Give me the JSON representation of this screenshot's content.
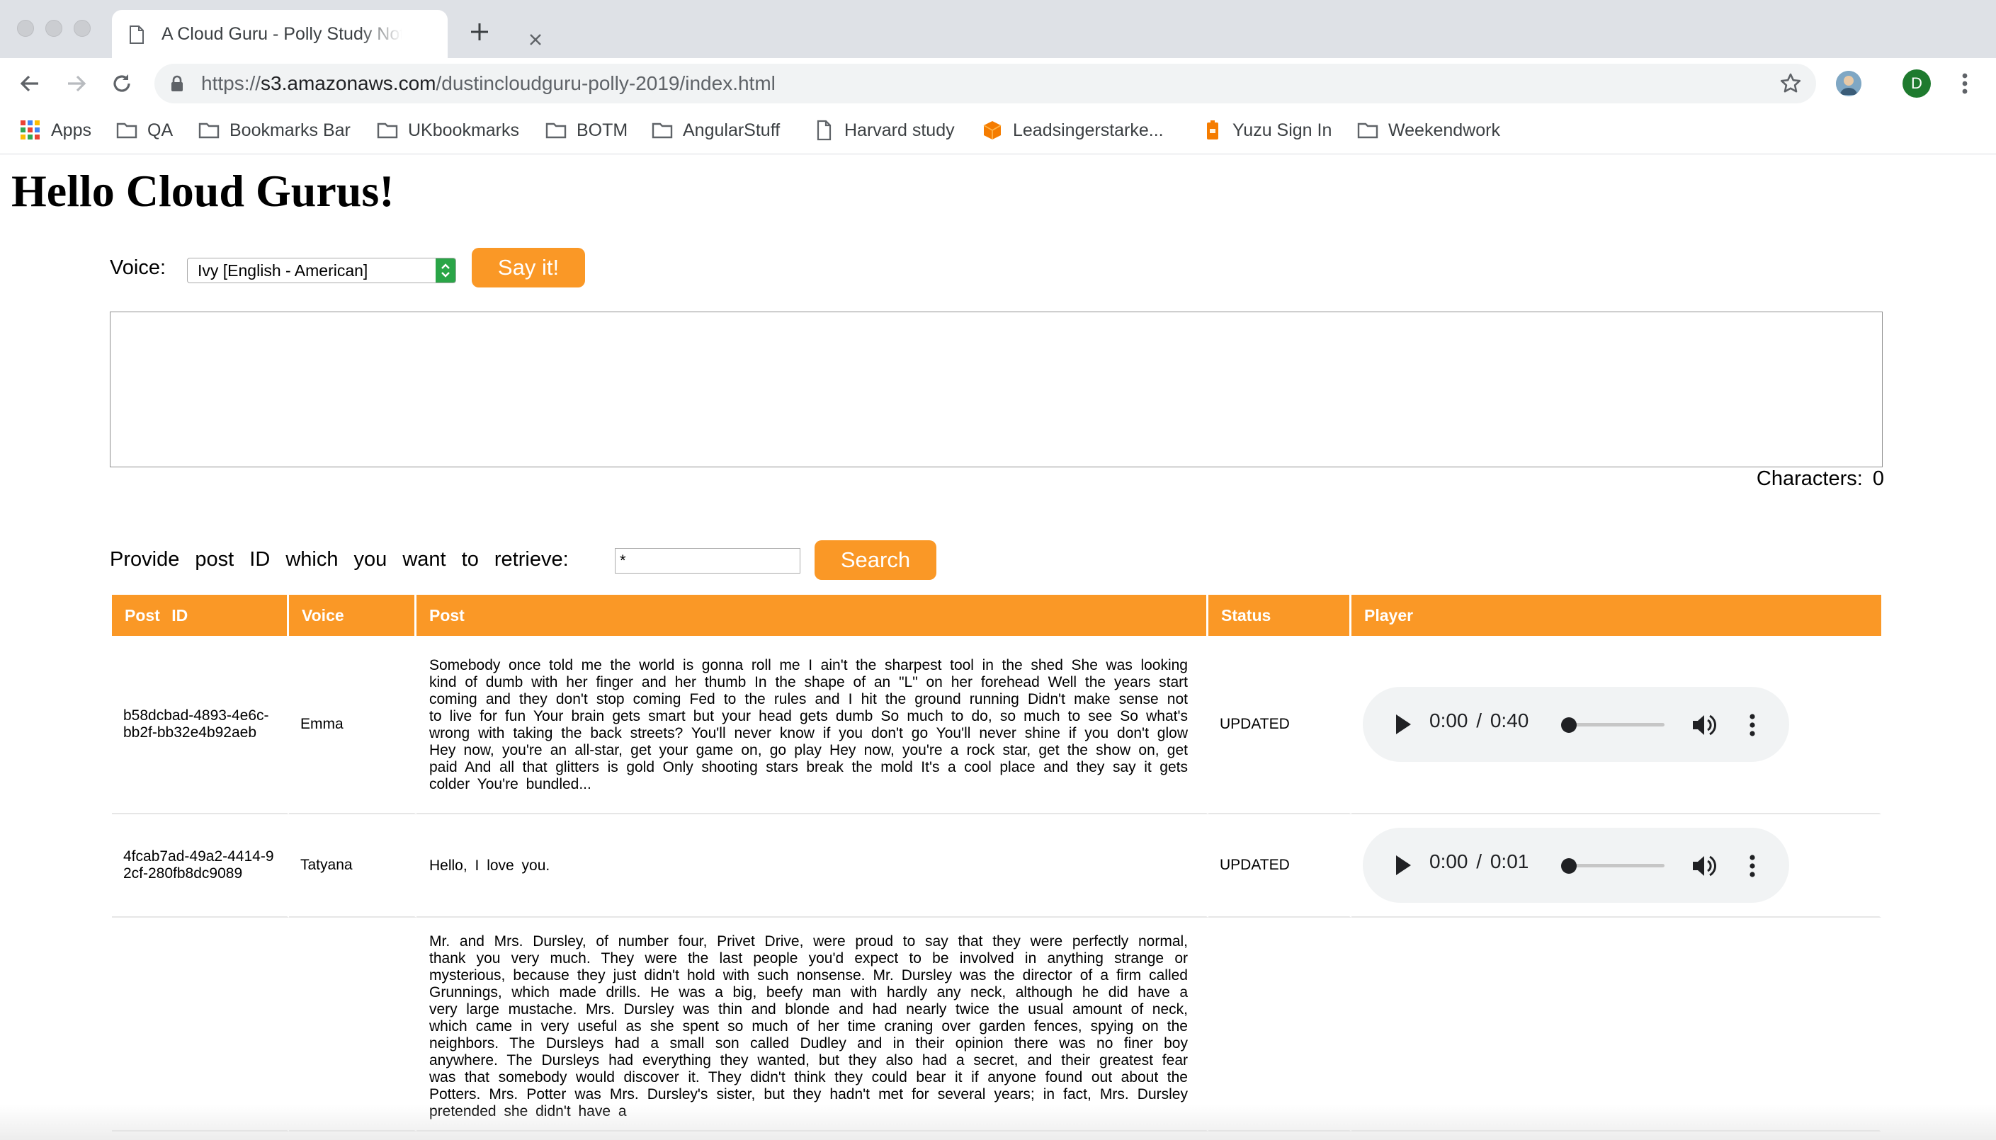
{
  "browser": {
    "tab_title": "A Cloud Guru - Polly Study Notes",
    "url_scheme": "https://",
    "url_host": "s3.amazonaws.com",
    "url_path": "/dustincloudguru-polly-2019/index.html",
    "profile_initial": "D",
    "bookmarks": [
      "Apps",
      "QA",
      "Bookmarks Bar",
      "UKbookmarks",
      "BOTM",
      "AngularStuff",
      "Harvard study",
      "Leadsingerstarke...",
      "Yuzu Sign In",
      "Weekendwork"
    ]
  },
  "page": {
    "title": "Hello Cloud Gurus!",
    "voice_label": "Voice:",
    "voice_selected": "Ivy [English - American]",
    "say_button": "Say it!",
    "textarea_value": "",
    "characters_label": "Characters:",
    "characters_count": "0",
    "provide_label": "Provide post ID which you want to retrieve:",
    "post_id_value": "*",
    "search_button": "Search"
  },
  "table": {
    "headers": [
      "Post ID",
      "Voice",
      "Post",
      "Status",
      "Player"
    ],
    "rows": [
      {
        "id": "b58dcbad-4893-4e6c-bb2f-bb32e4b92aeb",
        "voice": "Emma",
        "post": "Somebody once told me the world is gonna roll me I ain't the sharpest tool in the shed She was looking kind of dumb with her finger and her thumb In the shape of an \"L\" on her forehead Well the years start coming and they don't stop coming Fed to the rules and I hit the ground running Didn't make sense not to live for fun Your brain gets smart but your head gets dumb So much to do, so much to see So what's wrong with taking the back streets? You'll never know if you don't go You'll never shine if you don't glow Hey now, you're an all-star, get your game on, go play Hey now, you're a rock star, get the show on, get paid And all that glitters is gold Only shooting stars break the mold It's a cool place and they say it gets colder You're bundled...",
        "status": "UPDATED",
        "current_time": "0:00",
        "separator": "/",
        "duration": "0:40"
      },
      {
        "id": "4fcab7ad-49a2-4414-92cf-280fb8dc9089",
        "voice": "Tatyana",
        "post": "Hello, I love you.",
        "status": "UPDATED",
        "current_time": "0:00",
        "separator": "/",
        "duration": "0:01"
      },
      {
        "id": "",
        "voice": "",
        "post": "Mr. and Mrs. Dursley, of number four, Privet Drive, were proud to say that they were perfectly normal, thank you very much. They were the last people you'd expect to be involved in anything strange or mysterious, because they just didn't hold with such nonsense. Mr. Dursley was the director of a firm called Grunnings, which made drills. He was a big, beefy man with hardly any neck, although he did have a very large mustache. Mrs. Dursley was thin and blonde and had nearly twice the usual amount of neck, which came in very useful as she spent so much of her time craning over garden fences, spying on the neighbors. The Dursleys had a small son called Dudley and in their opinion there was no finer boy anywhere. The Dursleys had everything they wanted, but they also had a secret, and their greatest fear was that somebody would discover it. They didn't think they could bear it if anyone found out about the Potters. Mrs. Potter was Mrs. Dursley's sister, but they hadn't met for several years; in fact, Mrs. Dursley pretended she didn't have a",
        "status": "",
        "current_time": "",
        "separator": "",
        "duration": ""
      }
    ]
  },
  "colors": {
    "accent": "#fa9826",
    "select_arrow": "#2aa547"
  }
}
